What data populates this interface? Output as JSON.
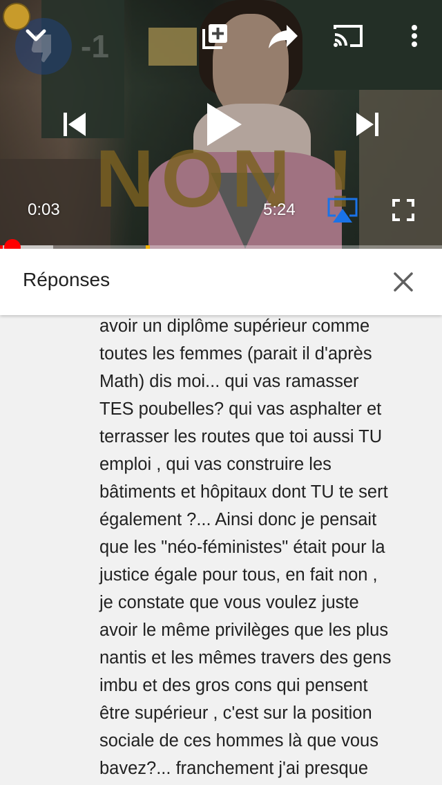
{
  "player": {
    "overlay_text": "NON !",
    "ghost_dislike_count": "-1",
    "current_time": "0:03",
    "duration": "5:24",
    "progress_fraction": 0.006,
    "buffered_fraction": 0.12,
    "marker_fraction": 0.33,
    "icons": {
      "collapse": "chevron-down-icon",
      "add_to_playlist": "add-to-playlist-icon",
      "share": "share-icon",
      "cast": "cast-icon",
      "more": "more-vert-icon",
      "previous": "skip-previous-icon",
      "play": "play-icon",
      "next": "skip-next-icon",
      "airplay": "airplay-icon",
      "fullscreen": "fullscreen-icon"
    },
    "colors": {
      "progress": "#ff0000",
      "airplay": "#1a73e8",
      "marker": "#f5b400"
    }
  },
  "replies_panel": {
    "title": "Réponses",
    "close_icon": "close-icon",
    "comment_lines": [
      "avoir un diplôme supérieur comme",
      "toutes les femmes (parait il d'après",
      "Math) dis moi... qui vas ramasser",
      "TES poubelles? qui vas asphalter et",
      "terrasser les routes que toi aussi TU",
      "emploi , qui vas construire les",
      "bâtiments et hôpitaux dont TU te sert",
      "également ?... Ainsi donc je pensait",
      "que les \"néo-féministes\" était pour la",
      "justice égale pour tous, en fait non ,",
      "je constate que vous voulez juste",
      "avoir le même privilèges que les plus",
      "nantis et les mêmes travers des gens",
      "imbu et des gros cons qui pensent",
      "être supérieur , c'est sur la position",
      "sociale de ces hommes là que vous",
      "bavez?... franchement j'ai presque"
    ]
  }
}
